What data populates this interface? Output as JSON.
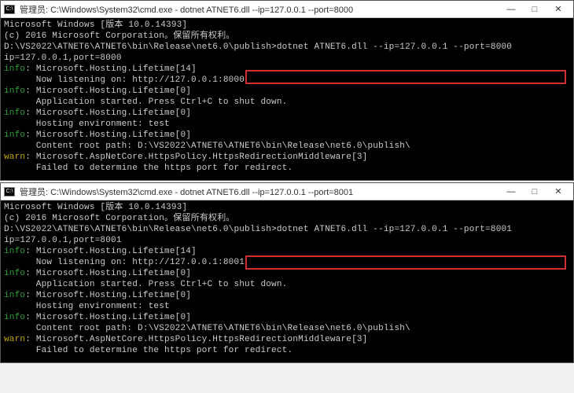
{
  "windows": [
    {
      "title": "管理员: C:\\Windows\\System32\\cmd.exe - dotnet  ATNET6.dll  --ip=127.0.0.1  --port=8000",
      "buttons": {
        "min": "—",
        "max": "□",
        "close": "✕"
      },
      "lines": [
        {
          "text": "Microsoft Windows [版本 10.0.14393]",
          "cls": "gray"
        },
        {
          "text": "(c) 2016 Microsoft Corporation。保留所有权利。",
          "cls": "gray"
        },
        {
          "text": "",
          "cls": "gray"
        },
        {
          "text": "D:\\VS2022\\ATNET6\\ATNET6\\bin\\Release\\net6.0\\publish>dotnet ATNET6.dll --ip=127.0.0.1 --port=8000",
          "cls": "gray"
        },
        {
          "text": "ip=127.0.0.1,port=8000",
          "cls": "gray"
        },
        {
          "prefix": "info",
          "rest": ": Microsoft.Hosting.Lifetime[14]"
        },
        {
          "text": "      Now listening on: http://127.0.0.1:8000",
          "cls": "gray"
        },
        {
          "prefix": "info",
          "rest": ": Microsoft.Hosting.Lifetime[0]"
        },
        {
          "text": "      Application started. Press Ctrl+C to shut down.",
          "cls": "gray"
        },
        {
          "prefix": "info",
          "rest": ": Microsoft.Hosting.Lifetime[0]"
        },
        {
          "text": "      Hosting environment: test",
          "cls": "gray"
        },
        {
          "prefix": "info",
          "rest": ": Microsoft.Hosting.Lifetime[0]"
        },
        {
          "text": "      Content root path: D:\\VS2022\\ATNET6\\ATNET6\\bin\\Release\\net6.0\\publish\\",
          "cls": "gray"
        },
        {
          "prefix": "warn",
          "rest": ": Microsoft.AspNetCore.HttpsPolicy.HttpsRedirectionMiddleware[3]"
        },
        {
          "text": "      Failed to determine the https port for redirect.",
          "cls": "gray"
        }
      ]
    },
    {
      "title": "管理员: C:\\Windows\\System32\\cmd.exe - dotnet  ATNET6.dll  --ip=127.0.0.1  --port=8001",
      "buttons": {
        "min": "—",
        "max": "□",
        "close": "✕"
      },
      "lines": [
        {
          "text": "Microsoft Windows [版本 10.0.14393]",
          "cls": "gray"
        },
        {
          "text": "(c) 2016 Microsoft Corporation。保留所有权利。",
          "cls": "gray"
        },
        {
          "text": "",
          "cls": "gray"
        },
        {
          "text": "D:\\VS2022\\ATNET6\\ATNET6\\bin\\Release\\net6.0\\publish>dotnet ATNET6.dll --ip=127.0.0.1 --port=8001",
          "cls": "gray"
        },
        {
          "text": "ip=127.0.0.1,port=8001",
          "cls": "gray"
        },
        {
          "prefix": "info",
          "rest": ": Microsoft.Hosting.Lifetime[14]"
        },
        {
          "text": "      Now listening on: http://127.0.0.1:8001",
          "cls": "gray"
        },
        {
          "prefix": "info",
          "rest": ": Microsoft.Hosting.Lifetime[0]"
        },
        {
          "text": "      Application started. Press Ctrl+C to shut down.",
          "cls": "gray"
        },
        {
          "prefix": "info",
          "rest": ": Microsoft.Hosting.Lifetime[0]"
        },
        {
          "text": "      Hosting environment: test",
          "cls": "gray"
        },
        {
          "prefix": "info",
          "rest": ": Microsoft.Hosting.Lifetime[0]"
        },
        {
          "text": "      Content root path: D:\\VS2022\\ATNET6\\ATNET6\\bin\\Release\\net6.0\\publish\\",
          "cls": "gray"
        },
        {
          "prefix": "warn",
          "rest": ": Microsoft.AspNetCore.HttpsPolicy.HttpsRedirectionMiddleware[3]"
        },
        {
          "text": "      Failed to determine the https port for redirect.",
          "cls": "gray"
        }
      ]
    }
  ]
}
